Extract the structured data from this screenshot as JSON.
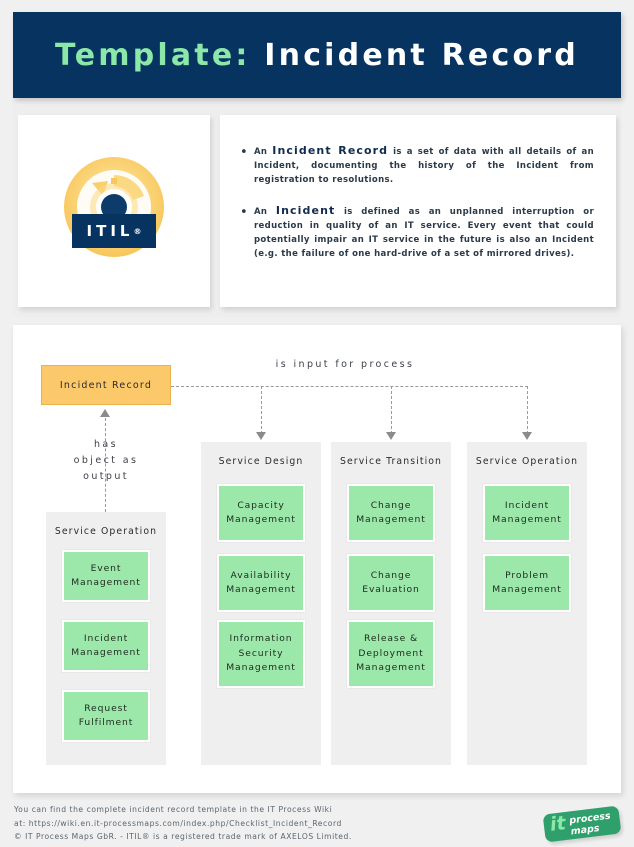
{
  "header": {
    "title_accent": "Template:",
    "title_main": " Incident Record"
  },
  "logo_card": {
    "icon": "itil-circular-arrows-icon",
    "wordmark": "ITIL",
    "wordmark_sup": "®"
  },
  "description": {
    "bullets": [
      {
        "marker": "•",
        "parts": [
          {
            "text": "An ",
            "emph": false
          },
          {
            "text": "Incident Record",
            "emph": true
          },
          {
            "text": " is a set of data with all details of an Incident, documenting the history of the Incident from registration to resolutions.",
            "emph": false
          }
        ]
      },
      {
        "marker": "•",
        "parts": [
          {
            "text": "An ",
            "emph": false
          },
          {
            "text": "Incident",
            "emph": true
          },
          {
            "text": " is defined as an unplanned interruption or reduction in quality of an IT service. Every event that could potentially impair an IT service in the future is also an Incident (e.g. the failure of one hard-drive of a set of mirrored drives).",
            "emph": false
          }
        ]
      }
    ]
  },
  "diagram": {
    "source_box": {
      "label": "Incident  Record",
      "color": "#fbc969"
    },
    "relations": {
      "is_input_for_process": "is input for process",
      "has_object_as_output": "has\nobject as\noutput"
    },
    "column_color": "#efefef",
    "process_color": "#9ce8ab",
    "columns": [
      {
        "title": "Service  Operation",
        "role": "output-lane",
        "processes": [
          "Event\nManagement",
          "Incident\nManagement",
          "Request\nFulfilment"
        ]
      },
      {
        "title": "Service  Design",
        "role": "input-lane",
        "processes": [
          "Capacity\nManagement",
          "Availability\nManagement",
          "Information\nSecurity\nManagement"
        ]
      },
      {
        "title": "Service  Transition",
        "role": "input-lane",
        "processes": [
          "Change\nManagement",
          "Change\nEvaluation",
          "Release  &\nDeployment\nManagement"
        ]
      },
      {
        "title": "Service  Operation",
        "role": "input-lane",
        "processes": [
          "Incident\nManagement",
          "Problem\nManagement"
        ]
      }
    ]
  },
  "footer": {
    "text": "You can find the complete incident record template in the IT Process Wiki\nat: https://wiki.en.it-processmaps.com/index.php/Checklist_Incident_Record\n© IT Process Maps GbR. - ITIL® is a registered trade mark of AXELOS Limited.",
    "logo": {
      "it": "it",
      "words": "process\nmaps",
      "color": "#2fa06b"
    }
  }
}
